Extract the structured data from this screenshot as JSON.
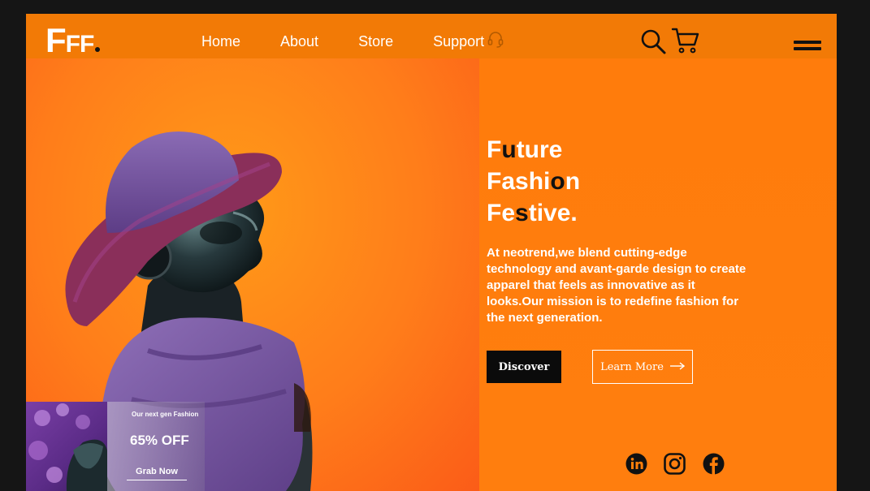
{
  "brand": {
    "logo_big": "F",
    "logo_small": "FF"
  },
  "nav": {
    "links": [
      {
        "label": "Home"
      },
      {
        "label": "About"
      },
      {
        "label": "Store"
      },
      {
        "label": "Support"
      }
    ],
    "icons": [
      "headset-icon",
      "search-icon",
      "cart-icon",
      "hamburger-menu-icon"
    ]
  },
  "hero": {
    "headline": [
      {
        "pre": "F",
        "dark": "u",
        "post": "ture"
      },
      {
        "pre": "Fashi",
        "dark": "o",
        "post": "n"
      },
      {
        "pre": "Fe",
        "dark": "s",
        "post": "tive."
      }
    ],
    "description": "At neotrend,we blend cutting-edge technology and avant-garde design to create apparel that feels as innovative as it looks.Our mission is to redefine fashion for the  next generation.",
    "discover_label": "Discover",
    "learn_more_label": "Learn More"
  },
  "promo": {
    "kicker": "Our next gen Fashion",
    "offer": "65% OFF",
    "cta": "Grab Now"
  },
  "social": [
    "linkedin-icon",
    "instagram-icon",
    "facebook-icon"
  ],
  "colors": {
    "accent": "#ff7f0a",
    "hat": "#7b5aa6",
    "dark": "#111111"
  }
}
